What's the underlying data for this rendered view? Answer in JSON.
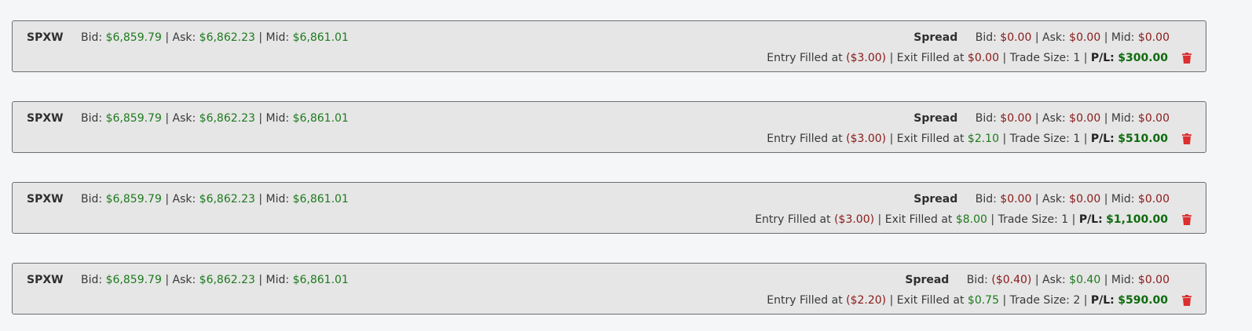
{
  "trades": [
    {
      "symbol": "SPXW",
      "bid_label": "Bid:",
      "bid": "$6,859.79",
      "ask_label": "Ask:",
      "ask": "$6,862.23",
      "mid_label": "Mid:",
      "mid": "$6,861.01",
      "spread_label": "Spread",
      "spread_bid": "$0.00",
      "spread_bid_color": "neg",
      "spread_ask": "$0.00",
      "spread_ask_color": "neg",
      "spread_mid": "$0.00",
      "spread_mid_color": "neg",
      "entry_label": "Entry Filled at",
      "entry": "($3.00)",
      "entry_color": "neg",
      "exit_label": "Exit Filled at",
      "exit": "$0.00",
      "exit_color": "neg",
      "size_label": "Trade Size:",
      "size": "1",
      "pl_label": "P/L:",
      "pl": "$300.00",
      "delete_icon": "trash-icon"
    },
    {
      "symbol": "SPXW",
      "bid_label": "Bid:",
      "bid": "$6,859.79",
      "ask_label": "Ask:",
      "ask": "$6,862.23",
      "mid_label": "Mid:",
      "mid": "$6,861.01",
      "spread_label": "Spread",
      "spread_bid": "$0.00",
      "spread_bid_color": "neg",
      "spread_ask": "$0.00",
      "spread_ask_color": "neg",
      "spread_mid": "$0.00",
      "spread_mid_color": "neg",
      "entry_label": "Entry Filled at",
      "entry": "($3.00)",
      "entry_color": "neg",
      "exit_label": "Exit Filled at",
      "exit": "$2.10",
      "exit_color": "pos",
      "size_label": "Trade Size:",
      "size": "1",
      "pl_label": "P/L:",
      "pl": "$510.00",
      "delete_icon": "trash-icon"
    },
    {
      "symbol": "SPXW",
      "bid_label": "Bid:",
      "bid": "$6,859.79",
      "ask_label": "Ask:",
      "ask": "$6,862.23",
      "mid_label": "Mid:",
      "mid": "$6,861.01",
      "spread_label": "Spread",
      "spread_bid": "$0.00",
      "spread_bid_color": "neg",
      "spread_ask": "$0.00",
      "spread_ask_color": "neg",
      "spread_mid": "$0.00",
      "spread_mid_color": "neg",
      "entry_label": "Entry Filled at",
      "entry": "($3.00)",
      "entry_color": "neg",
      "exit_label": "Exit Filled at",
      "exit": "$8.00",
      "exit_color": "pos",
      "size_label": "Trade Size:",
      "size": "1",
      "pl_label": "P/L:",
      "pl": "$1,100.00",
      "delete_icon": "trash-icon"
    },
    {
      "symbol": "SPXW",
      "bid_label": "Bid:",
      "bid": "$6,859.79",
      "ask_label": "Ask:",
      "ask": "$6,862.23",
      "mid_label": "Mid:",
      "mid": "$6,861.01",
      "spread_label": "Spread",
      "spread_bid": "($0.40)",
      "spread_bid_color": "neg",
      "spread_ask": "$0.40",
      "spread_ask_color": "pos",
      "spread_mid": "$0.00",
      "spread_mid_color": "neg",
      "entry_label": "Entry Filled at",
      "entry": "($2.20)",
      "entry_color": "neg",
      "exit_label": "Exit Filled at",
      "exit": "$0.75",
      "exit_color": "pos",
      "size_label": "Trade Size:",
      "size": "2",
      "pl_label": "P/L:",
      "pl": "$590.00",
      "delete_icon": "trash-icon"
    }
  ],
  "colors": {
    "positive": "#1d7a1d",
    "negative": "#8a1a1a",
    "pl": "#0f6b0f",
    "trash": "#dc2f2f",
    "card_bg": "#e6e6e6",
    "page_bg": "#f5f6f8"
  }
}
